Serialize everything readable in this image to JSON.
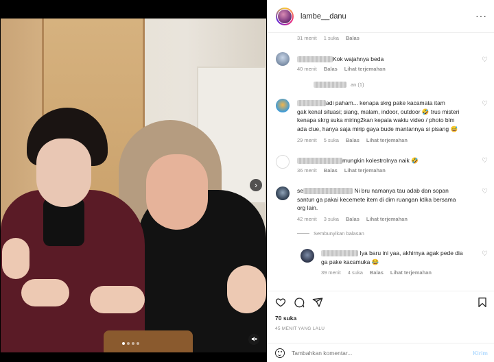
{
  "header": {
    "username": "lambe__danu"
  },
  "comments": [
    {
      "meta": {
        "time": "31 menit",
        "likes": "1 suka",
        "reply": "Balas"
      }
    },
    {
      "text": "Kok wajahnya beda",
      "meta": {
        "time": "40 menit",
        "likes": "",
        "reply": "Balas",
        "translate": "Lihat terjemahan"
      }
    },
    {
      "replies_text": "an (1)"
    },
    {
      "text_lines": [
        "adi paham... kenapa skrg pake kacamata itam",
        "gak kenal situasi; siang, malam, indoor, outdoor 🤣 trus misteri",
        "kenapa skrg suka miring2kan kepala waktu video / photo blm",
        "ada clue, hanya saja mirip gaya bude mantannya si pisang 😅"
      ],
      "meta": {
        "time": "29 menit",
        "likes": "5 suka",
        "reply": "Balas",
        "translate": "Lihat terjemahan"
      }
    },
    {
      "text": "mungkin kolestrolnya naik 🤣",
      "meta": {
        "time": "36 menit",
        "reply": "Balas",
        "translate": "Lihat terjemahan"
      }
    },
    {
      "prefix": "se",
      "text_lines": [
        "Ni bru namanya tau adab dan sopan",
        "santun ga pakai kecemete item di dim ruangan ktika bersama",
        "org lain."
      ],
      "meta": {
        "time": "42 menit",
        "likes": "3 suka",
        "reply": "Balas",
        "translate": "Lihat terjemahan"
      }
    },
    {
      "hide_replies": "Sembunyikan balasan"
    },
    {
      "text_lines": [
        "Iya baru ini yaa, akhirnya agak pede dia",
        "ga pake kacamuka 😂"
      ],
      "meta": {
        "time": "39 menit",
        "likes": "4 suka",
        "reply": "Balas",
        "translate": "Lihat terjemahan"
      }
    }
  ],
  "footer": {
    "likes": "70 suka",
    "time_ago": "45 MENIT YANG LALU",
    "comment_placeholder": "Tambahkan komentar...",
    "post_label": "Kirim"
  }
}
